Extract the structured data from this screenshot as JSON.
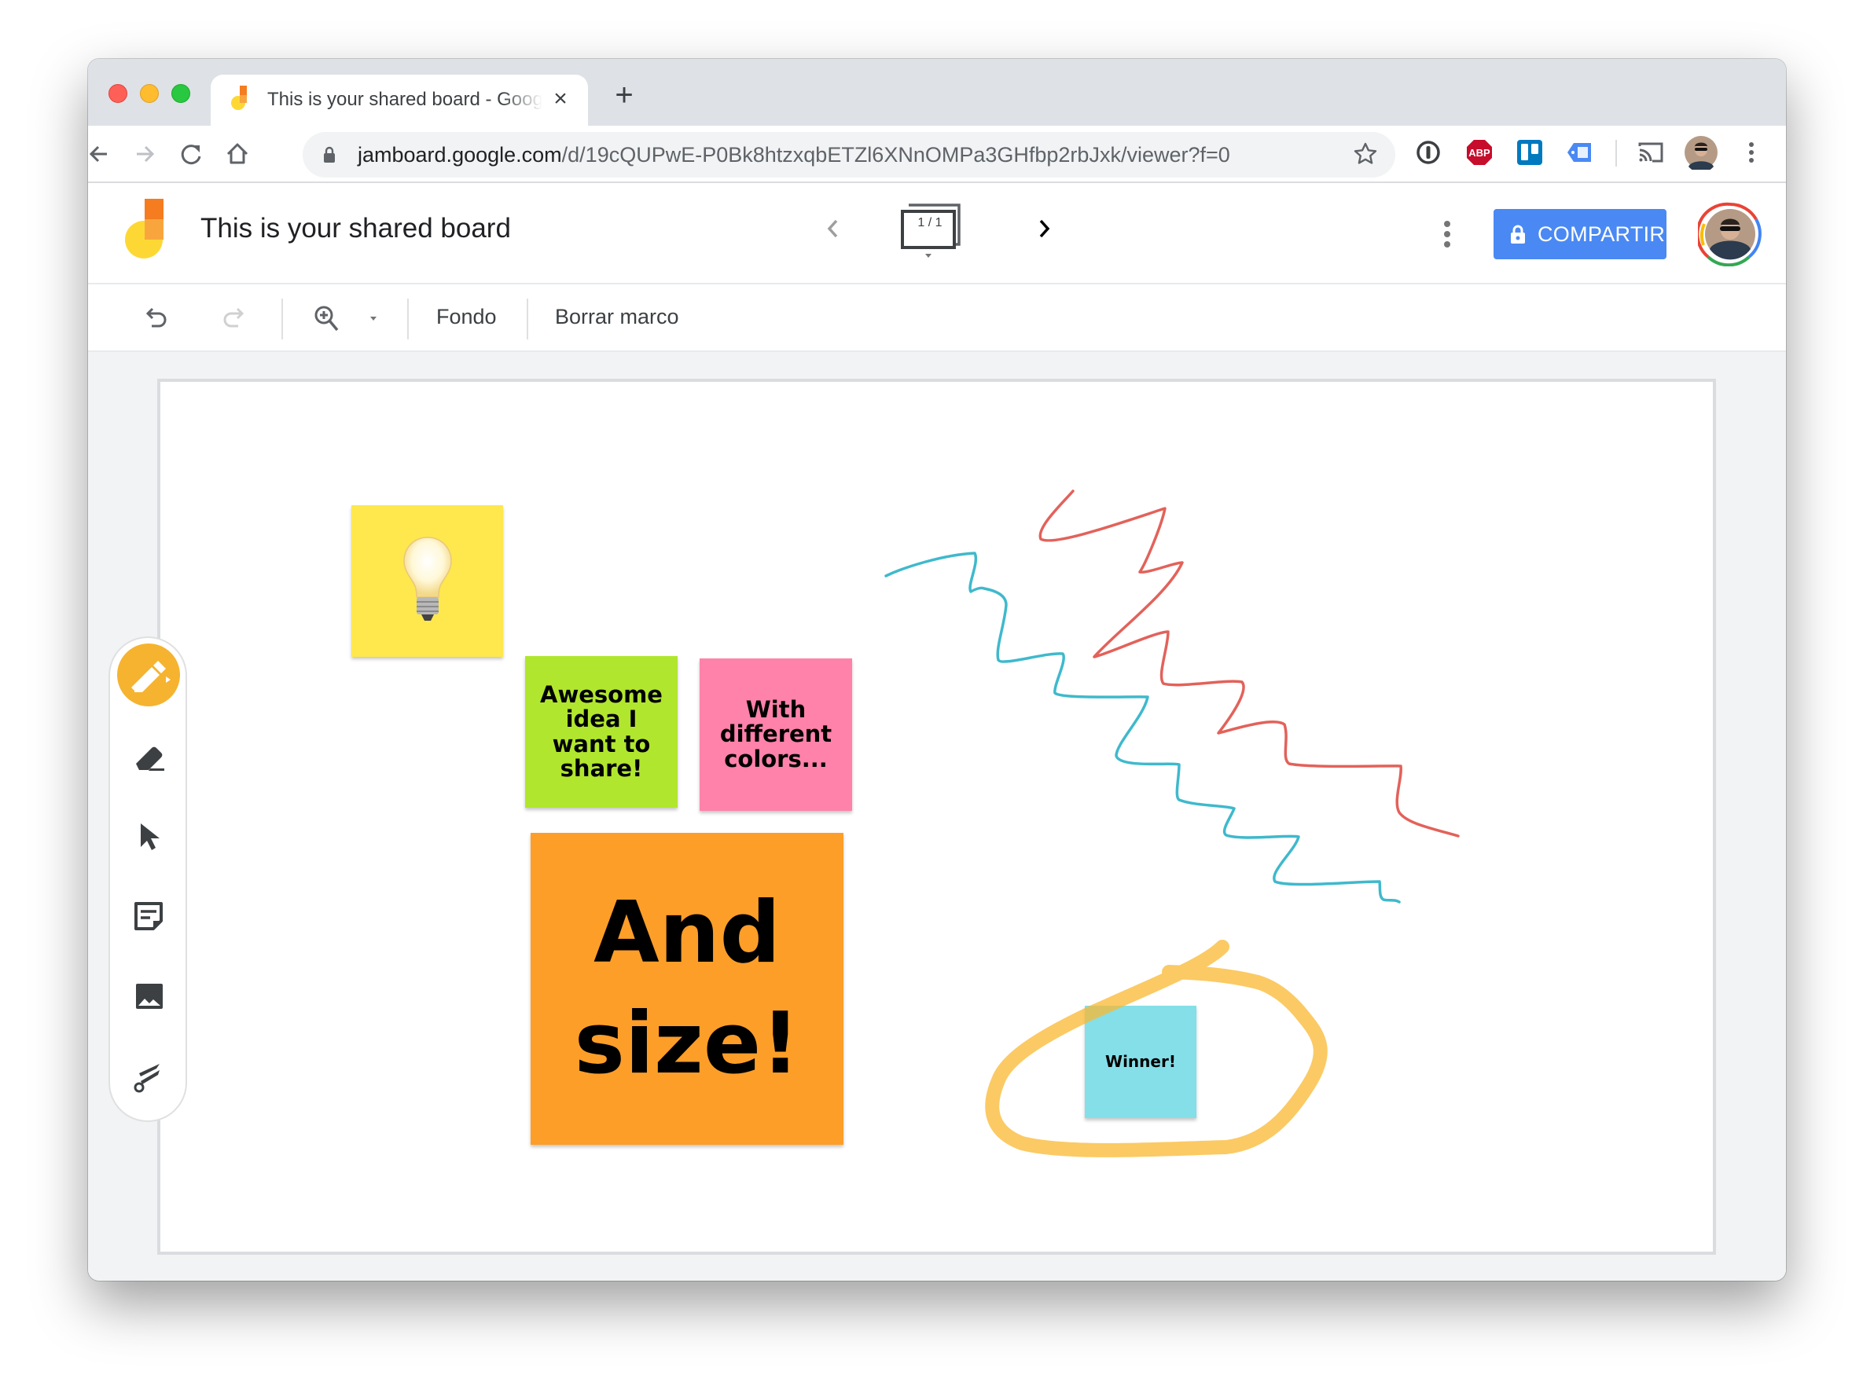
{
  "browser": {
    "tab": {
      "title": "This is your shared board - Google Jamboard",
      "close_icon": "close-icon",
      "favicon": "jamboard-favicon"
    },
    "new_tab_label": "+",
    "url_host": "jamboard.google.com",
    "url_path": "/d/19cQUPwE-P0Bk8htzxqbETZl6XNnOMPa3GHfbp2rbJxk/viewer?f=0",
    "nav_icons": [
      "back-icon",
      "forward-icon",
      "reload-icon",
      "home-icon"
    ],
    "extensions": [
      "1password-icon",
      "adblock-plus-icon",
      "trello-icon",
      "tag-extension-icon",
      "cast-icon",
      "profile-avatar",
      "chrome-menu-icon"
    ],
    "extension_labels": {
      "abp": "ABP"
    }
  },
  "app": {
    "title": "This is your shared board",
    "pager": {
      "label": "1 / 1",
      "current": 1,
      "total": 1
    },
    "share_label": "COMPARTIR",
    "colors": {
      "share": "#4a89f3",
      "active_tool": "#f5b32f"
    }
  },
  "toolbar": {
    "undo": "undo-icon",
    "redo": "redo-icon",
    "zoom": "zoom-in-icon",
    "background_label": "Fondo",
    "clear_frame_label": "Borrar marco"
  },
  "tools": [
    {
      "name": "pen",
      "icon": "pen-icon",
      "active": true
    },
    {
      "name": "eraser",
      "icon": "eraser-icon",
      "active": false
    },
    {
      "name": "select",
      "icon": "select-arrow-icon",
      "active": false
    },
    {
      "name": "sticky-note",
      "icon": "sticky-note-icon",
      "active": false
    },
    {
      "name": "image",
      "icon": "image-icon",
      "active": false
    },
    {
      "name": "laser",
      "icon": "laser-icon",
      "active": false
    }
  ],
  "board": {
    "notes": [
      {
        "id": "lightbulb",
        "text": "",
        "emoji": "💡",
        "color": "#fee84e"
      },
      {
        "id": "awesome",
        "text": "Awesome\nidea I\nwant to\nshare!",
        "color": "#b1e62e"
      },
      {
        "id": "colors",
        "text": "With\ndifferent\ncolors...",
        "color": "#fe82aa"
      },
      {
        "id": "size",
        "text": "And\nsize!",
        "color": "#fd9e29"
      },
      {
        "id": "winner",
        "text": "Winner!",
        "color": "#84dfe8"
      }
    ],
    "strokes": [
      {
        "name": "blue-squiggle",
        "color": "#3fb9cc"
      },
      {
        "name": "red-squiggle",
        "color": "#e2625a"
      },
      {
        "name": "yellow-highlighter-circle",
        "color": "#f9b830"
      }
    ]
  }
}
